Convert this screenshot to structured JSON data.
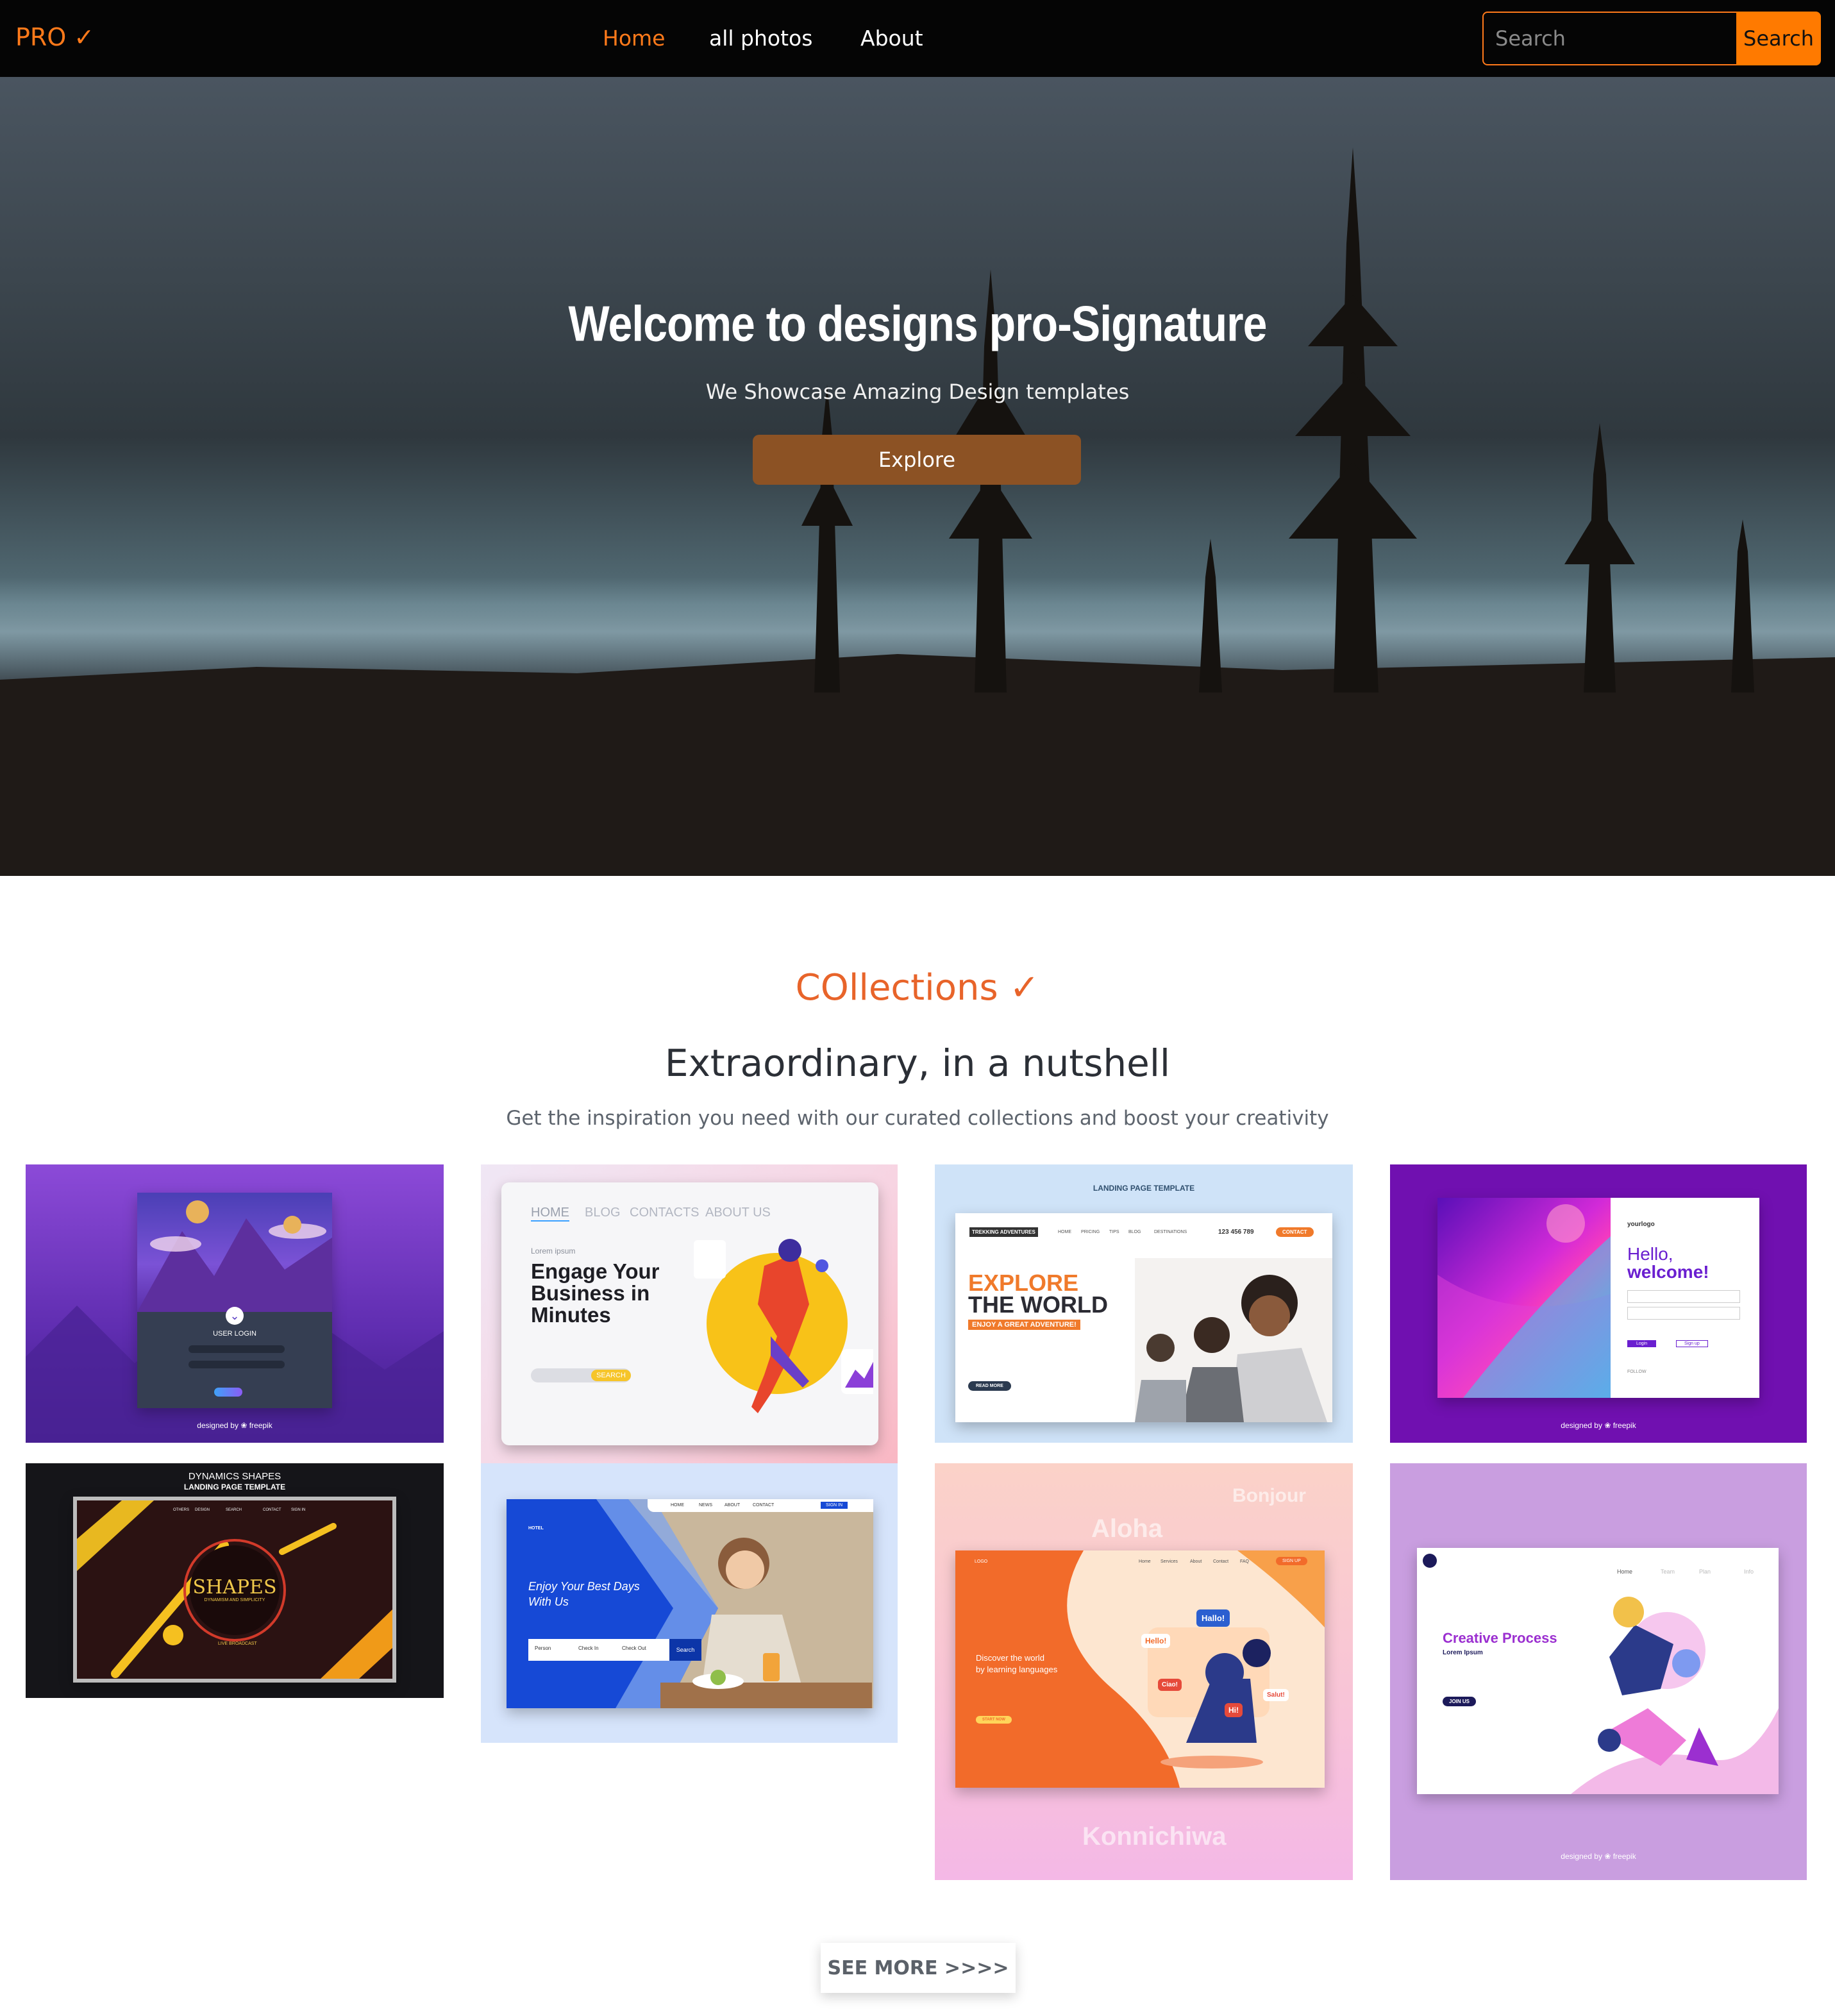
{
  "navbar": {
    "brand": "PRO ✓",
    "links": [
      {
        "label": "Home",
        "active": true
      },
      {
        "label": "all photos",
        "active": false
      },
      {
        "label": "About",
        "active": false
      }
    ],
    "search": {
      "placeholder": "Search",
      "value": "",
      "button_label": "Search"
    }
  },
  "hero": {
    "title": "Welcome to designs pro-Signature",
    "subtitle": "We Showcase Amazing Design templates",
    "cta_label": "Explore"
  },
  "collections": {
    "title": "COllections ✓",
    "heading": "Extraordinary, in a nutshell",
    "description": "Get the inspiration you need with our curated collections and boost your creativity",
    "cards": [
      {
        "name": "user-login-template",
        "login_title": "USER LOGIN",
        "credit": "designed by ❀ freepik"
      },
      {
        "name": "engage-business-template",
        "nav": [
          "HOME",
          "BLOG",
          "CONTACTS",
          "ABOUT US"
        ],
        "kicker": "Lorem ipsum",
        "headline_lines": [
          "Engage Your",
          "Business in",
          "Minutes"
        ],
        "search_label": "SEARCH"
      },
      {
        "name": "explore-world-template",
        "header": "LANDING PAGE TEMPLATE",
        "logo": "TREKKING ADVENTURES",
        "phone": "123 456 789",
        "nav": [
          "HOME",
          "PRICING",
          "TIPS",
          "BLOG",
          "DESTINATIONS"
        ],
        "contact_button": "CONTACT",
        "headline_lines": [
          "EXPLORE",
          "THE WORLD"
        ],
        "tagline": "ENJOY A GREAT ADVENTURE!",
        "cta": "READ MORE"
      },
      {
        "name": "hello-welcome-template",
        "logo": "yourlogo",
        "greeting": "Hello,",
        "welcome": "welcome!",
        "login_button": "Login",
        "signup_button": "Sign up",
        "follow": "FOLLOW",
        "credit": "designed by ❀ freepik"
      },
      {
        "name": "dynamics-shapes-template",
        "header_lines": [
          "DYNAMICS SHAPES",
          "LANDING PAGE TEMPLATE"
        ],
        "nav": [
          "OTHERS",
          "DESIGN",
          "SEARCH",
          "CONTACT",
          "SIGN IN"
        ],
        "logo": "SHAPES",
        "logo_sub": "DYNAMISM AND SIMPLICITY",
        "footer": "LIVE BROADCAST"
      },
      {
        "name": "hotel-template",
        "logo": "HOTEL",
        "nav": [
          "HOME",
          "NEWS",
          "ABOUT",
          "CONTACT",
          "SIGN IN"
        ],
        "headline_lines": [
          "Enjoy Your Best Days",
          "With Us"
        ],
        "fields": [
          "Person",
          "Check In",
          "Check Out"
        ],
        "search_button": "Search"
      },
      {
        "name": "languages-template",
        "logo": "LOGO",
        "nav": [
          "Home",
          "Services",
          "About",
          "Contact",
          "FAQ"
        ],
        "signup": "SIGN UP",
        "bg_words": [
          "Bonjour",
          "Aloha",
          "Konnichiwa"
        ],
        "bubbles": [
          "Hallo!",
          "Hello!",
          "Ciao!",
          "Salut!",
          "Hi!"
        ],
        "headline_lines": [
          "Discover the world",
          "by learning languages"
        ],
        "cta": "START NOW"
      },
      {
        "name": "creative-process-template",
        "nav": [
          "Home",
          "Team",
          "Plan",
          "Info"
        ],
        "headline": "Creative Process",
        "sub": "Lorem Ipsum",
        "cta": "JOIN US",
        "credit": "designed by ❀ freepik"
      }
    ],
    "see_more_label": "SEE MORE >>>>"
  },
  "colors": {
    "accent": "#ff7a1a",
    "navbar_bg": "#050505",
    "explore_button": "#8c5224",
    "collections_title": "#e8642a"
  }
}
